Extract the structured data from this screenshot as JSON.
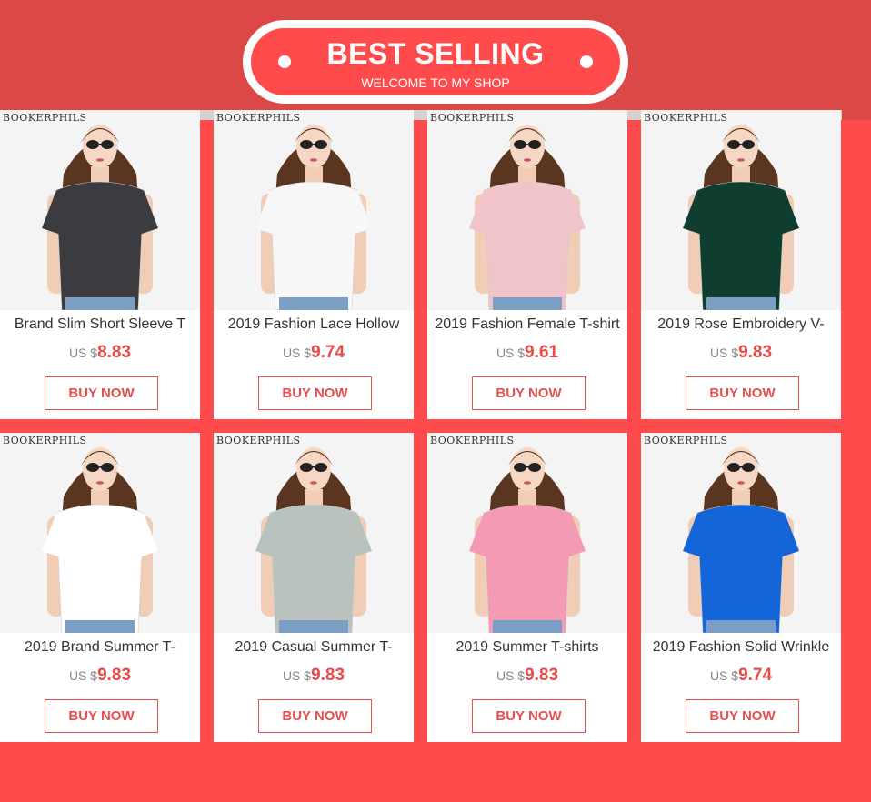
{
  "banner": {
    "title": "BEST SELLING",
    "subtitle": "WELCOME TO MY SHOP"
  },
  "watermark": "BOOKERPHILS",
  "currency_label": "US $",
  "buy_label": "BUY NOW",
  "products": [
    {
      "title": "Brand Slim Short Sleeve T",
      "price": "8.83",
      "shirt_color": "#3c3c40",
      "image": "woman-in-dark-grey-tshirt"
    },
    {
      "title": "2019 Fashion Lace Hollow",
      "price": "9.74",
      "shirt_color": "#f7f7f7",
      "image": "woman-in-white-lace-tshirt"
    },
    {
      "title": "2019 Fashion Female T-shirt",
      "price": "9.61",
      "shirt_color": "#f0c4c8",
      "image": "woman-in-pink-striped-tshirt"
    },
    {
      "title": "2019 Rose Embroidery V-",
      "price": "9.83",
      "shirt_color": "#0f3d30",
      "image": "woman-in-green-vneck-tshirt"
    },
    {
      "title": "2019 Brand Summer T-",
      "price": "9.83",
      "shirt_color": "#ffffff",
      "image": "woman-in-white-flower-print-tshirt"
    },
    {
      "title": "2019 Casual Summer T-",
      "price": "9.83",
      "shirt_color": "#b9c2bd",
      "image": "woman-in-grey-leaf-print-tshirt"
    },
    {
      "title": "2019 Summer T-shirts",
      "price": "9.83",
      "shirt_color": "#f49bb3",
      "image": "woman-in-pink-print-tshirt"
    },
    {
      "title": "2019 Fashion Solid Wrinkle",
      "price": "9.74",
      "shirt_color": "#1466d8",
      "image": "woman-in-blue-tshirt"
    }
  ],
  "colors": {
    "background": "#ff4b4b",
    "banner_band": "#dc4848",
    "accent": "#e55050"
  }
}
